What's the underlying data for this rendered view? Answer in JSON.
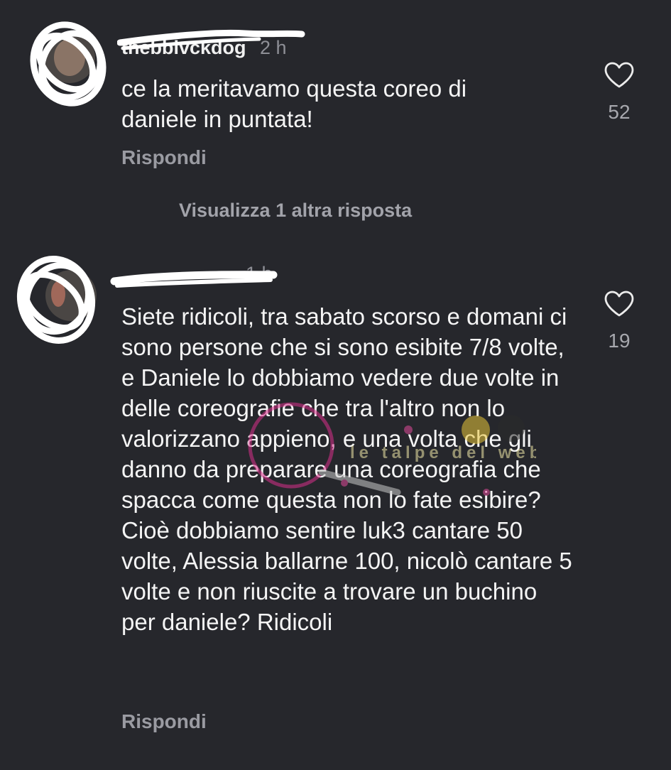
{
  "comments": [
    {
      "username": "thebbivckdog",
      "time": "2 h",
      "text": "ce la meritavamo questa coreo di daniele in puntata!",
      "likes": "52",
      "reply_label": "Rispondi"
    },
    {
      "username": "",
      "time": "1 h",
      "text": "Siete ridicoli, tra sabato scorso e domani ci sono persone che si sono esibite 7/8 volte, e Daniele lo dobbiamo vedere due volte in delle coreografie che tra l'altro non lo valorizzano appieno, e una volta che gli danno da preparare una coreografia che spacca come questa non lo fate esibire? Cioè dobbiamo sentire luk3 cantare 50 volte, Alessia ballarne 100, nicolò cantare 5 volte e non riuscite a trovare un buchino per daniele? Ridicoli",
      "likes": "19",
      "reply_label": "Rispondi"
    }
  ],
  "view_replies_label": "Visualizza 1 altra risposta",
  "watermark_text": "le talpe del web",
  "icons": {
    "like": "heart-outline-icon"
  },
  "colors": {
    "background": "#26272c",
    "text": "#f4f4f4",
    "muted": "#9a9ba2",
    "watermark_pink": "#d9308c"
  }
}
